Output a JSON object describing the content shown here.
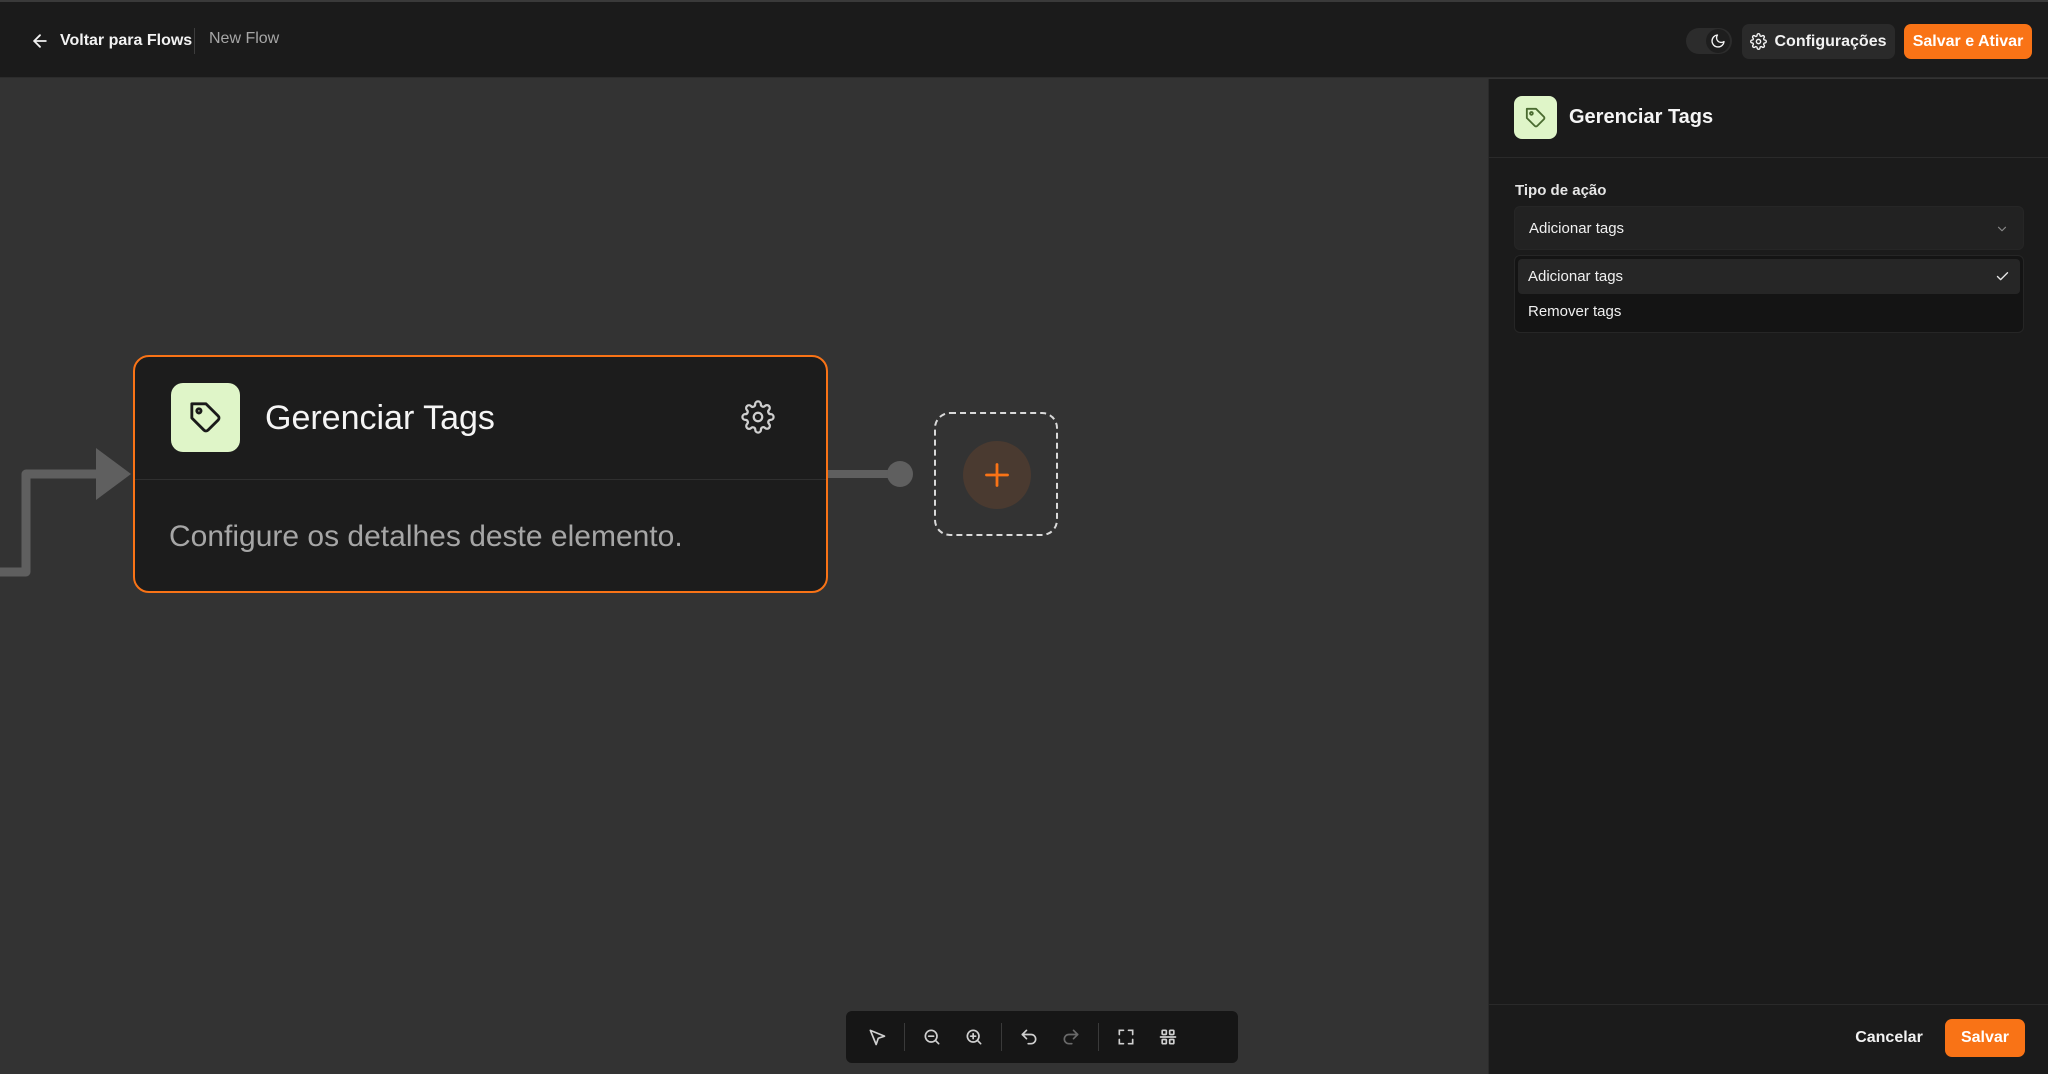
{
  "header": {
    "back_label": "Voltar para Flows",
    "flow_name": "New Flow",
    "settings_label": "Configurações",
    "save_activate_label": "Salvar e Ativar"
  },
  "canvas": {
    "node": {
      "title": "Gerenciar Tags",
      "description": "Configure os detalhes deste elemento.",
      "icon": "tag-icon"
    }
  },
  "toolbar": {
    "icons": [
      "select-pointer-icon",
      "zoom-out-icon",
      "zoom-in-icon",
      "undo-icon",
      "redo-icon",
      "fit-view-icon",
      "auto-layout-icon"
    ]
  },
  "panel": {
    "title": "Gerenciar Tags",
    "field_label": "Tipo de ação",
    "select_value": "Adicionar tags",
    "options": [
      {
        "label": "Adicionar tags",
        "selected": true
      },
      {
        "label": "Remover tags",
        "selected": false
      }
    ],
    "cancel_label": "Cancelar",
    "save_label": "Salvar"
  },
  "colors": {
    "accent": "#f97316",
    "icon_bg": "#dff5c8",
    "canvas_bg": "#333333",
    "panel_bg": "#1b1b1b"
  }
}
